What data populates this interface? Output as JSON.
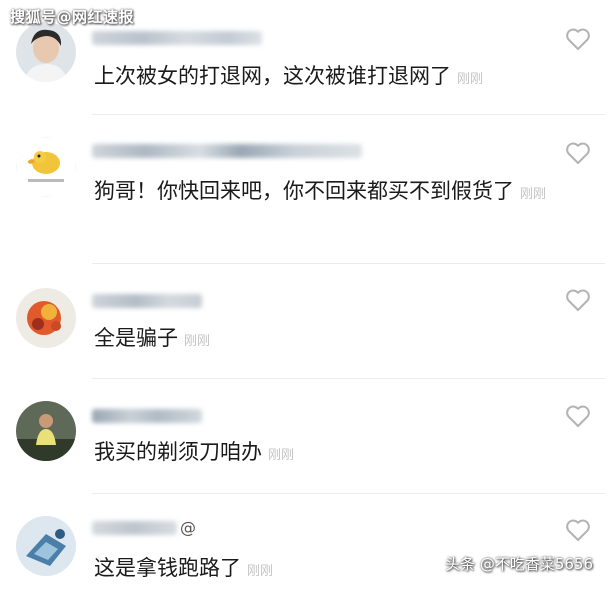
{
  "watermark_top": "搜狐号@网红速报",
  "watermark_bottom": "头条 @不吃香菜5656",
  "comments": [
    {
      "text": "上次被女的打退网，这次被谁打退网了",
      "time": "刚刚",
      "avatar_icon": "user-avatar-icon",
      "like_icon": "heart-icon"
    },
    {
      "text": "狗哥！你快回来吧，你不回来都买不到假货了",
      "time": "刚刚",
      "avatar_icon": "duck-avatar-icon",
      "like_icon": "heart-icon"
    },
    {
      "text": "全是骗子",
      "time": "刚刚",
      "avatar_icon": "user-avatar-icon",
      "like_icon": "heart-icon"
    },
    {
      "text": "我买的剃须刀咱办",
      "time": "刚刚",
      "avatar_icon": "user-avatar-icon",
      "like_icon": "heart-icon"
    },
    {
      "text": "这是拿钱跑路了",
      "time": "刚刚",
      "name_suffix": "@",
      "avatar_icon": "user-avatar-icon",
      "like_icon": "heart-icon"
    }
  ]
}
